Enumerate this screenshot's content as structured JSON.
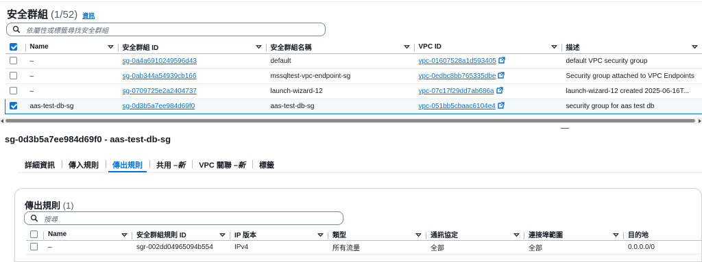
{
  "top": {
    "title": "安全群組",
    "count": "(1/52)",
    "info_link": "資訊",
    "search_placeholder": "依屬性或標籤尋找安全群組",
    "columns": [
      "Name",
      "安全群組 ID",
      "安全群組名稱",
      "VPC ID",
      "描述"
    ],
    "rows": [
      {
        "name": "–",
        "id": "sg-0a4a6910249596d43",
        "group_name": "default",
        "vpc": "vpc-01607528a1d593405",
        "desc": "default VPC security group",
        "checked": false
      },
      {
        "name": "–",
        "id": "sg-0ab344a54939cb166",
        "group_name": "mssqltest-vpc-endpoint-sg",
        "vpc": "vpc-0edbc8bb765335dbe",
        "desc": "Security group attached to VPC Endpoints",
        "checked": false
      },
      {
        "name": "–",
        "id": "sg-0709725e2a2404737",
        "group_name": "launch-wizard-12",
        "vpc": "vpc-07c17f29dd7ab686a",
        "desc": "launch-wizard-12 created 2025-06-16T...",
        "checked": false
      },
      {
        "name": "aas-test-db-sg",
        "id": "sg-0d3b5a7ee984d69f0",
        "group_name": "aas-test-db-sg",
        "vpc": "vpc-051bb5cbaac6104e4",
        "desc": "security group for aas test db",
        "checked": true
      }
    ]
  },
  "detail": {
    "title": "sg-0d3b5a7ee984d69f0 - aas-test-db-sg",
    "tabs": [
      {
        "label": "詳細資訊",
        "suffix": ""
      },
      {
        "label": "傳入規則",
        "suffix": ""
      },
      {
        "label": "傳出規則",
        "suffix": ""
      },
      {
        "label": "共用 – ",
        "suffix": "新"
      },
      {
        "label": "VPC 關聯 – ",
        "suffix": "新"
      },
      {
        "label": "標籤",
        "suffix": ""
      }
    ],
    "active_tab": 2,
    "card": {
      "title": "傳出規則",
      "count": "(1)",
      "search_placeholder": "搜尋",
      "columns": [
        "Name",
        "安全群組規則 ID",
        "IP 版本",
        "類型",
        "通訊協定",
        "連接埠範圍",
        "目的地"
      ],
      "rows": [
        {
          "name": "–",
          "rule_id": "sgr-002dd04965094b554",
          "ip": "IPv4",
          "type": "所有流量",
          "protocol": "全部",
          "ports": "全部",
          "dest": "0.0.0.0/0"
        }
      ]
    }
  },
  "colors": {
    "link": "#0972d3",
    "selected_bg": "#f2f8fd",
    "text": "#16191f"
  }
}
